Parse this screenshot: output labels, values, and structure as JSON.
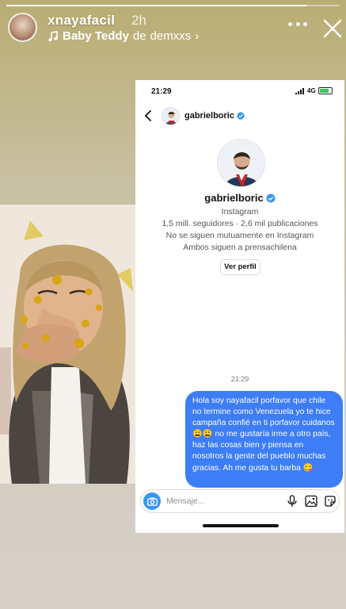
{
  "story": {
    "progress": 0.9,
    "username": "xnayafacil",
    "time_ago": "2h",
    "music": {
      "song": "Baby Teddy",
      "connector": "de",
      "artist": "demxxs",
      "chevron": "›"
    },
    "icons": {
      "music": "music-note-icon",
      "more": "more-dots-icon",
      "close": "close-icon"
    }
  },
  "dm": {
    "status_bar": {
      "time": "21:29",
      "network": "4G"
    },
    "header": {
      "username": "gabrielboric",
      "verified": true
    },
    "profile": {
      "name": "gabrielboric",
      "platform": "Instagram",
      "stats": "1,5 mill. seguidores · 2,6 mil publicaciones",
      "follow_status": "No se siguen mutuamente en Instagram",
      "mutual": "Ambos siguen a prensachilena",
      "view_profile_label": "Ver perfil"
    },
    "messages": [
      {
        "time": "21:29",
        "text": "Hola soy nayafacil porfavor que chile no termine como Venezuela yo te hice campaña confié en ti porfavor cuidanos😩😩 no me gustaría irme a otro país, haz las cosas bien y piensa en nosotros la gente del pueblo muchas gracias. Ah me gusta tu barba 😋"
      }
    ],
    "composer": {
      "placeholder": "Mensaje..."
    }
  },
  "colors": {
    "accent": "#3d7df6",
    "verified": "#3897f0",
    "story_bg": "#c8c0a2"
  }
}
